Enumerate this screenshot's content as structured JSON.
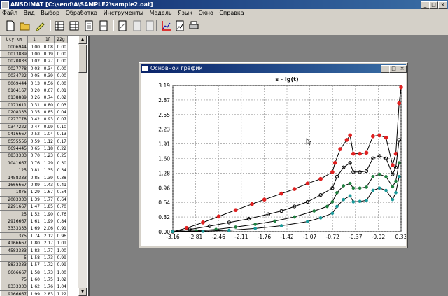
{
  "window": {
    "title": "ANSDIMAT [C:\\send\\A\\SAMPLE2\\sample2.oat]",
    "minimize": "_",
    "maximize": "□",
    "close": "×"
  },
  "menu": [
    "Файл",
    "Вид",
    "Выбор",
    "Обработка",
    "Инструменты",
    "Модель",
    "Язык",
    "Окно",
    "Справка"
  ],
  "toolbar": [
    "new-icon",
    "open-icon",
    "edit-icon",
    "grid1-icon",
    "grid2-icon",
    "doc1-icon",
    "doc2-icon",
    "doc3-icon",
    "doc4-icon",
    "chart-icon",
    "graph-icon",
    "print-icon"
  ],
  "table": {
    "headers": [
      "t сутки",
      "1",
      "1f",
      "22g"
    ],
    "rows": [
      [
        "0006944",
        "0.00",
        "0.08",
        "0.00"
      ],
      [
        "0013889",
        "0.00",
        "0.19",
        "0.00"
      ],
      [
        "0020833",
        "0.02",
        "0.27",
        "0.00"
      ],
      [
        "0027778",
        "0.03",
        "0.34",
        "0.00"
      ],
      [
        "0034722",
        "0.05",
        "0.39",
        "0.00"
      ],
      [
        "0069444",
        "0.13",
        "0.56",
        "0.00"
      ],
      [
        "0104167",
        "0.20",
        "0.67",
        "0.01"
      ],
      [
        "0138889",
        "0.26",
        "0.74",
        "0.02"
      ],
      [
        "0173611",
        "0.31",
        "0.80",
        "0.03"
      ],
      [
        "0208333",
        "0.35",
        "0.85",
        "0.04"
      ],
      [
        "0277778",
        "0.42",
        "0.93",
        "0.07"
      ],
      [
        "0347222",
        "0.47",
        "0.99",
        "0.10"
      ],
      [
        "0416667",
        "0.52",
        "1.04",
        "0.13"
      ],
      [
        "0555556",
        "0.59",
        "1.12",
        "0.17"
      ],
      [
        "0694445",
        "0.65",
        "1.18",
        "0.22"
      ],
      [
        "0833333",
        "0.70",
        "1.23",
        "0.25"
      ],
      [
        "1041667",
        "0.76",
        "1.29",
        "0.30"
      ],
      [
        "125",
        "0.81",
        "1.35",
        "0.34"
      ],
      [
        "1458333",
        "0.85",
        "1.39",
        "0.38"
      ],
      [
        "1666667",
        "0.89",
        "1.43",
        "0.41"
      ],
      [
        "1875",
        "1.29",
        "1.67",
        "0.54"
      ],
      [
        "2083333",
        "1.39",
        "1.77",
        "0.64"
      ],
      [
        "2291667",
        "1.47",
        "1.85",
        "0.70"
      ],
      [
        "25",
        "1.52",
        "1.90",
        "0.76"
      ],
      [
        "2916667",
        "1.61",
        "1.99",
        "0.84"
      ],
      [
        "3333333",
        "1.69",
        "2.06",
        "0.91"
      ],
      [
        "375",
        "1.74",
        "2.12",
        "0.96"
      ],
      [
        "4166667",
        "1.80",
        "2.17",
        "1.01"
      ],
      [
        "4583333",
        "1.82",
        "1.77",
        "1.00"
      ],
      [
        "5",
        "1.58",
        "1.73",
        "0.99"
      ],
      [
        "5833333",
        "1.57",
        "1.72",
        "0.99"
      ],
      [
        "6666667",
        "1.58",
        "1.73",
        "1.00"
      ],
      [
        "75",
        "1.60",
        "1.75",
        "1.02"
      ],
      [
        "8333333",
        "1.62",
        "1.76",
        "1.04"
      ],
      [
        "9166667",
        "1.99",
        "2.83",
        "1.22"
      ]
    ]
  },
  "graph_window": {
    "title": "Основной график",
    "minimize": "_",
    "maximize": "□",
    "close": "×"
  },
  "chart_data": {
    "type": "scatter",
    "title": "s - lg(t)",
    "xlabel": "",
    "ylabel": "",
    "xlim": [
      -3.16,
      0.33
    ],
    "ylim": [
      0.0,
      3.19
    ],
    "x_ticks": [
      "-3.16",
      "-2.81",
      "-2.46",
      "-2.11",
      "-1.76",
      "-1.42",
      "-1.07",
      "-0.72",
      "-0.37",
      "-0.02",
      "0.33"
    ],
    "y_ticks": [
      "0.00",
      "0.32",
      "0.64",
      "0.96",
      "1.28",
      "1.60",
      "1.91",
      "2.23",
      "2.55",
      "2.87",
      "3.19"
    ],
    "grid": true,
    "series": [
      {
        "color": "#e02020",
        "points": [
          [
            -3.16,
            0.0
          ],
          [
            -2.95,
            0.08
          ],
          [
            -2.7,
            0.2
          ],
          [
            -2.46,
            0.33
          ],
          [
            -2.2,
            0.47
          ],
          [
            -1.95,
            0.6
          ],
          [
            -1.76,
            0.7
          ],
          [
            -1.5,
            0.83
          ],
          [
            -1.3,
            0.93
          ],
          [
            -1.1,
            1.05
          ],
          [
            -0.9,
            1.15
          ],
          [
            -0.72,
            1.3
          ],
          [
            -0.68,
            1.5
          ],
          [
            -0.6,
            1.8
          ],
          [
            -0.5,
            2.0
          ],
          [
            -0.45,
            2.1
          ],
          [
            -0.4,
            1.7
          ],
          [
            -0.3,
            1.7
          ],
          [
            -0.2,
            1.72
          ],
          [
            -0.1,
            2.08
          ],
          [
            0.0,
            2.1
          ],
          [
            0.1,
            2.05
          ],
          [
            0.2,
            1.45
          ],
          [
            0.25,
            1.7
          ],
          [
            0.3,
            2.8
          ],
          [
            0.33,
            3.15
          ]
        ]
      },
      {
        "color": "#202020",
        "points": [
          [
            -3.16,
            0.0
          ],
          [
            -2.9,
            0.05
          ],
          [
            -2.6,
            0.12
          ],
          [
            -2.3,
            0.2
          ],
          [
            -2.0,
            0.28
          ],
          [
            -1.7,
            0.38
          ],
          [
            -1.5,
            0.45
          ],
          [
            -1.3,
            0.55
          ],
          [
            -1.1,
            0.65
          ],
          [
            -0.9,
            0.8
          ],
          [
            -0.72,
            0.95
          ],
          [
            -0.65,
            1.2
          ],
          [
            -0.55,
            1.4
          ],
          [
            -0.45,
            1.5
          ],
          [
            -0.4,
            1.3
          ],
          [
            -0.3,
            1.3
          ],
          [
            -0.2,
            1.32
          ],
          [
            -0.1,
            1.6
          ],
          [
            0.0,
            1.65
          ],
          [
            0.1,
            1.6
          ],
          [
            0.2,
            1.25
          ],
          [
            0.25,
            1.4
          ],
          [
            0.3,
            2.0
          ]
        ]
      },
      {
        "color": "#208040",
        "points": [
          [
            -3.16,
            0.0
          ],
          [
            -2.8,
            0.02
          ],
          [
            -2.5,
            0.05
          ],
          [
            -2.2,
            0.1
          ],
          [
            -1.9,
            0.16
          ],
          [
            -1.6,
            0.23
          ],
          [
            -1.3,
            0.32
          ],
          [
            -1.0,
            0.45
          ],
          [
            -0.8,
            0.55
          ],
          [
            -0.72,
            0.65
          ],
          [
            -0.65,
            0.85
          ],
          [
            -0.55,
            1.0
          ],
          [
            -0.45,
            1.05
          ],
          [
            -0.4,
            0.95
          ],
          [
            -0.3,
            0.95
          ],
          [
            -0.2,
            0.97
          ],
          [
            -0.1,
            1.2
          ],
          [
            0.0,
            1.25
          ],
          [
            0.1,
            1.2
          ],
          [
            0.2,
            0.98
          ],
          [
            0.25,
            1.1
          ],
          [
            0.3,
            1.5
          ]
        ]
      },
      {
        "color": "#1a9a9a",
        "points": [
          [
            -3.16,
            0.0
          ],
          [
            -2.7,
            0.01
          ],
          [
            -2.3,
            0.03
          ],
          [
            -1.9,
            0.07
          ],
          [
            -1.5,
            0.13
          ],
          [
            -1.1,
            0.22
          ],
          [
            -0.9,
            0.3
          ],
          [
            -0.72,
            0.4
          ],
          [
            -0.65,
            0.55
          ],
          [
            -0.55,
            0.7
          ],
          [
            -0.45,
            0.78
          ],
          [
            -0.4,
            0.65
          ],
          [
            -0.3,
            0.66
          ],
          [
            -0.2,
            0.68
          ],
          [
            -0.1,
            0.9
          ],
          [
            0.0,
            0.95
          ],
          [
            0.1,
            0.9
          ],
          [
            0.2,
            0.7
          ],
          [
            0.25,
            0.85
          ],
          [
            0.3,
            1.2
          ]
        ]
      }
    ]
  }
}
